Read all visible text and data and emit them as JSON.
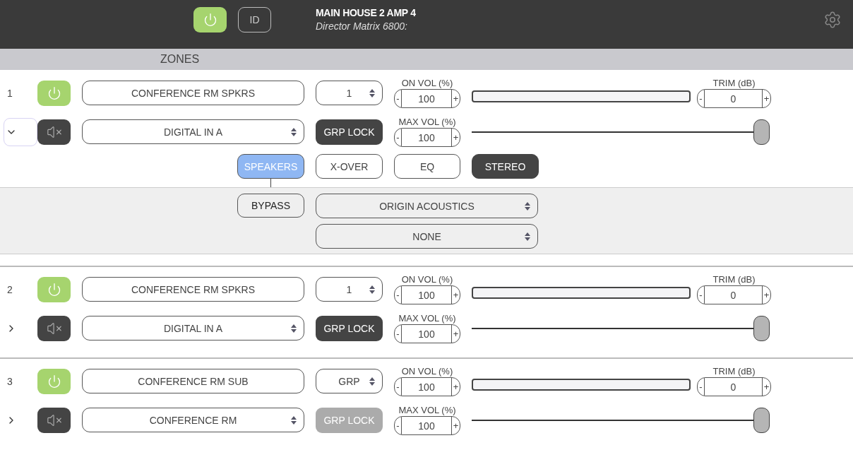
{
  "header": {
    "power_on": true,
    "id_button": "ID",
    "title": "MAIN HOUSE 2 AMP 4",
    "subtitle": "Director Matrix 6800:"
  },
  "zones_heading": "ZONES",
  "zones": [
    {
      "number": "1",
      "power_on": true,
      "expanded": true,
      "name": "CONFERENCE RM SPKRS",
      "group": "1",
      "source": "DIGITAL IN A",
      "grp_lock": {
        "label": "GRP LOCK",
        "disabled": false
      },
      "on_vol": {
        "label": "ON VOL (%)",
        "minus": "-",
        "value": "100",
        "plus": "+"
      },
      "max_vol": {
        "label": "MAX VOL (%)",
        "minus": "-",
        "value": "100",
        "plus": "+"
      },
      "trim": {
        "label": "TRIM (dB)",
        "minus": "-",
        "value": "0",
        "plus": "+"
      },
      "max_slider": {
        "level": 1
      },
      "tabs": [
        {
          "label": "SPEAKERS",
          "kind": "tab",
          "selected": true
        },
        {
          "label": "X-OVER",
          "kind": "tab",
          "selected": false
        },
        {
          "label": "EQ",
          "kind": "tab",
          "selected": false
        },
        {
          "label": "STEREO",
          "kind": "toggle",
          "on": true
        }
      ],
      "speaker_panel": {
        "bypass": "BYPASS",
        "brand": "ORIGIN ACOUSTICS",
        "model": "NONE"
      }
    },
    {
      "number": "2",
      "power_on": true,
      "expanded": false,
      "name": "CONFERENCE RM SPKRS",
      "group": "1",
      "source": "DIGITAL IN A",
      "grp_lock": {
        "label": "GRP LOCK",
        "disabled": false
      },
      "on_vol": {
        "label": "ON VOL (%)",
        "minus": "-",
        "value": "100",
        "plus": "+"
      },
      "max_vol": {
        "label": "MAX VOL (%)",
        "minus": "-",
        "value": "100",
        "plus": "+"
      },
      "trim": {
        "label": "TRIM (dB)",
        "minus": "-",
        "value": "0",
        "plus": "+"
      },
      "max_slider": {
        "level": 1
      }
    },
    {
      "number": "3",
      "power_on": true,
      "expanded": false,
      "name": "CONFERENCE RM SUB",
      "group": "GRP",
      "source": "CONFERENCE RM",
      "grp_lock": {
        "label": "GRP LOCK",
        "disabled": true
      },
      "on_vol": {
        "label": "ON VOL (%)",
        "minus": "-",
        "value": "100",
        "plus": "+"
      },
      "max_vol": {
        "label": "MAX VOL (%)",
        "minus": "-",
        "value": "100",
        "plus": "+"
      },
      "trim": {
        "label": "TRIM (dB)",
        "minus": "-",
        "value": "0",
        "plus": "+"
      },
      "max_slider": {
        "level": 1
      }
    }
  ]
}
